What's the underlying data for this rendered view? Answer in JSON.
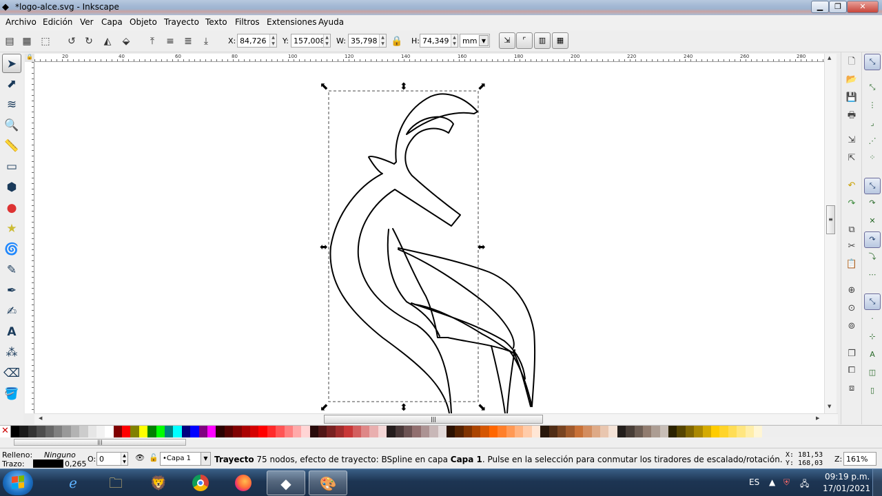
{
  "window": {
    "title": "*logo-alce.svg - Inkscape",
    "icons": {
      "app": "inkscape-icon",
      "minimize": "minimize-icon",
      "maximize": "maximize-icon",
      "close": "close-icon"
    }
  },
  "menu": [
    "Archivo",
    "Edición",
    "Ver",
    "Capa",
    "Objeto",
    "Trayecto",
    "Texto",
    "Filtros",
    "Extensiones",
    "Ayuda"
  ],
  "tool_controls": {
    "x_label": "X:",
    "x_value": "84,726",
    "y_label": "Y:",
    "y_value": "157,008",
    "w_label": "W:",
    "w_value": "35,798",
    "h_label": "H:",
    "h_value": "74,349",
    "unit": "mm"
  },
  "canvas": {
    "ruler_ticks": [
      "20",
      "40",
      "60",
      "80",
      "100",
      "120",
      "140",
      "160",
      "180",
      "200",
      "220",
      "240",
      "260",
      "280"
    ],
    "colors": {
      "stroke": "#000000",
      "selection": "#444444"
    }
  },
  "palette": {
    "none_label": "✕",
    "swatches": [
      "#000000",
      "#1a1a1a",
      "#333333",
      "#4d4d4d",
      "#666666",
      "#808080",
      "#999999",
      "#b3b3b3",
      "#cccccc",
      "#e6e6e6",
      "#f2f2f2",
      "#ffffff",
      "#800000",
      "#ff0000",
      "#808000",
      "#ffff00",
      "#008000",
      "#00ff00",
      "#008080",
      "#00ffff",
      "#000080",
      "#0000ff",
      "#800080",
      "#ff00ff",
      "#2b0000",
      "#550000",
      "#800000",
      "#aa0000",
      "#d40000",
      "#ff0000",
      "#ff2a2a",
      "#ff5555",
      "#ff8080",
      "#ffaaaa",
      "#ffd5d5",
      "#280b0b",
      "#501616",
      "#782121",
      "#a02c2c",
      "#c83737",
      "#d35f5f",
      "#de8787",
      "#e9afaf",
      "#f4d7d7",
      "#241c1c",
      "#483737",
      "#6c5353",
      "#916f6f",
      "#ac9393",
      "#c8b7b7",
      "#e3dbdb",
      "#2b1100",
      "#552200",
      "#803300",
      "#aa4400",
      "#d45500",
      "#ff6600",
      "#ff7f2a",
      "#ff9955",
      "#ffb380",
      "#ffccaa",
      "#ffe6d5",
      "#28170b",
      "#502d16",
      "#784421",
      "#a05a2c",
      "#c87137",
      "#d38d5f",
      "#deaa87",
      "#e9c6af",
      "#f4e3d7",
      "#241f1c",
      "#483e37",
      "#6c5d53",
      "#917c6f",
      "#ac9d93",
      "#c8beb7",
      "#2b2200",
      "#554400",
      "#806600",
      "#aa8800",
      "#d4aa00",
      "#ffcc00",
      "#ffd42a",
      "#ffdd55",
      "#ffe680",
      "#ffeeaa",
      "#fff6d5"
    ]
  },
  "status": {
    "fill_label": "Relleno:",
    "fill_value": "Ninguno",
    "stroke_label": "Trazo:",
    "stroke_width": "0,265",
    "opacity_label": "O:",
    "opacity_value": "0",
    "layer": "•Capa 1",
    "msg_bold1": "Trayecto",
    "msg_mid": " 75 nodos, efecto de trayecto: BSpline en capa ",
    "msg_bold2": "Capa 1",
    "msg_end": ". Pulse en la selección para conmutar los tiradores de escalado/rotación.",
    "coord_x": "X:  181,53",
    "coord_y": "Y:  168,03",
    "zoom_label": "Z:",
    "zoom_value": "161%"
  },
  "taskbar": {
    "lang": "ES",
    "time": "09:19 p.m.",
    "date": "17/01/2021",
    "apps": [
      "internet-explorer-icon",
      "file-explorer-icon",
      "brave-icon",
      "chrome-icon",
      "firefox-icon",
      "inkscape-icon",
      "paint-icon"
    ]
  }
}
